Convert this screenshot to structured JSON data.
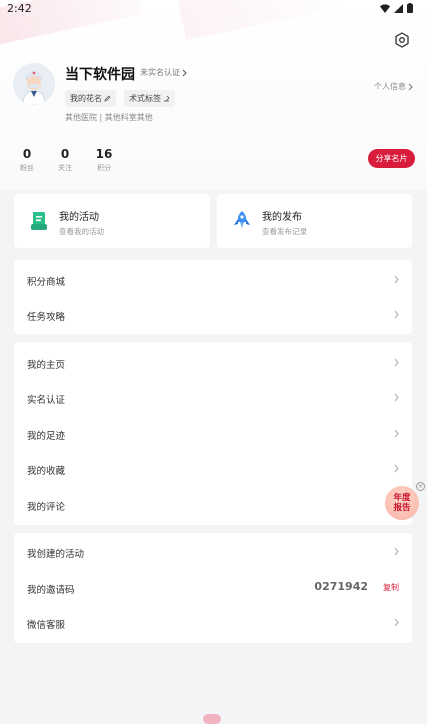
{
  "status_bar": {
    "time": "2:42"
  },
  "profile": {
    "name": "当下软件园",
    "verify_status": "未实名认证",
    "tags": [
      "我的花名",
      "术式标签"
    ],
    "hospital": "其他医院 | 其他科室其他",
    "personal_info": "个人信息"
  },
  "stats": [
    {
      "value": "0",
      "label": "粉丝"
    },
    {
      "value": "0",
      "label": "关注"
    },
    {
      "value": "16",
      "label": "积分"
    }
  ],
  "share_card": "分享名片",
  "quick_actions": [
    {
      "title": "我的活动",
      "subtitle": "查看我的活动",
      "icon": "activity-icon"
    },
    {
      "title": "我的发布",
      "subtitle": "查看发布记录",
      "icon": "rocket-icon"
    }
  ],
  "menu_group1": [
    "积分商城",
    "任务攻略"
  ],
  "menu_group2": [
    "我的主页",
    "实名认证",
    "我的足迹",
    "我的收藏",
    "我的评论"
  ],
  "menu_group3": {
    "created_activities": "我创建的活动",
    "invite_code_label": "我的邀请码",
    "invite_code": "0271942",
    "copy": "复制",
    "wechat_service": "微信客服"
  },
  "float_badge": {
    "line1": "年度",
    "line2": "报告"
  },
  "colors": {
    "accent": "#d81d3c",
    "activity_icon": "#2bbf8a",
    "rocket_icon": "#3b8ef0"
  }
}
